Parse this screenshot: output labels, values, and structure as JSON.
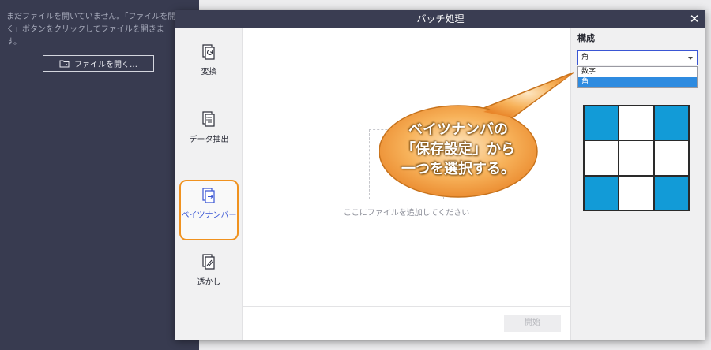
{
  "background_app": {
    "empty_message": "まだファイルを開いていません。「ファイルを開く」ボタンをクリックしてファイルを開きます。",
    "open_button_label": "ファイルを開く…",
    "open_icon": "folder-open-icon"
  },
  "dialog": {
    "title": "バッチ処理",
    "close_label": "✕"
  },
  "sidebar": {
    "items": [
      {
        "label": "変換",
        "icon": "convert-icon"
      },
      {
        "label": "データ抽出",
        "icon": "data-extract-icon"
      },
      {
        "label": "ベイツナンバー",
        "icon": "bates-number-icon",
        "active": true
      },
      {
        "label": "透かし",
        "icon": "watermark-icon"
      }
    ]
  },
  "main": {
    "drop_hint": "ここにファイルを追加してください",
    "start_button": "開始"
  },
  "panel": {
    "title": "構成",
    "select_value": "角",
    "options": [
      "数字",
      "角"
    ],
    "selected_option_index": 1,
    "grid_filled": [
      true,
      false,
      true,
      false,
      false,
      false,
      true,
      false,
      true
    ]
  },
  "callout": {
    "line1": "ベイツナンバの",
    "line2": "「保存設定」から",
    "line3": "一つを選択する。"
  },
  "colors": {
    "accent": "#3a56d4",
    "highlight": "#f0921f",
    "grid_fill": "#129bd7",
    "titlebar": "#3a3d52"
  }
}
